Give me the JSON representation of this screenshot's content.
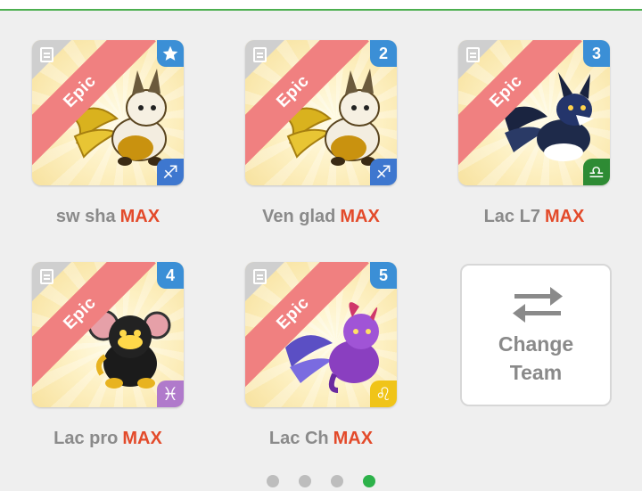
{
  "colors": {
    "accent_green": "#4caf50",
    "max_red": "#e34a2a",
    "epic_ribbon": "#f08080",
    "number_badge": "#3b8fd6",
    "dot_inactive": "#bdbdbd",
    "dot_active": "#2db24a"
  },
  "team": [
    {
      "badge": "",
      "badge_icon": "star-icon",
      "ribbon": "Epic",
      "zodiac_icon": "sagittarius-icon",
      "zodiac_symbol": "♐",
      "zodiac_color": "#3e77cf",
      "name": "sw sha",
      "level": "MAX",
      "creature": "golden-winged-cat"
    },
    {
      "badge": "2",
      "ribbon": "Epic",
      "zodiac_icon": "sagittarius-icon",
      "zodiac_symbol": "♐",
      "zodiac_color": "#3e77cf",
      "name": "Ven glad",
      "level": "MAX",
      "creature": "golden-winged-cat"
    },
    {
      "badge": "3",
      "ribbon": "Epic",
      "zodiac_icon": "libra-icon",
      "zodiac_symbol": "♎",
      "zodiac_color": "#2e8b34",
      "name": "Lac L7",
      "level": "MAX",
      "creature": "blue-black-wolf"
    },
    {
      "badge": "4",
      "ribbon": "Epic",
      "zodiac_icon": "pisces-icon",
      "zodiac_symbol": "♓",
      "zodiac_color": "#b07acb",
      "name": "Lac pro",
      "level": "MAX",
      "creature": "black-gold-mouse"
    },
    {
      "badge": "5",
      "ribbon": "Epic",
      "zodiac_icon": "leo-icon",
      "zodiac_symbol": "♌",
      "zodiac_color": "#f0c418",
      "name": "Lac Ch",
      "level": "MAX",
      "creature": "purple-winged-beast"
    }
  ],
  "change_team": {
    "line1": "Change",
    "line2": "Team",
    "icon": "swap-arrows-icon"
  },
  "pagination": {
    "total": 4,
    "active": 4
  }
}
